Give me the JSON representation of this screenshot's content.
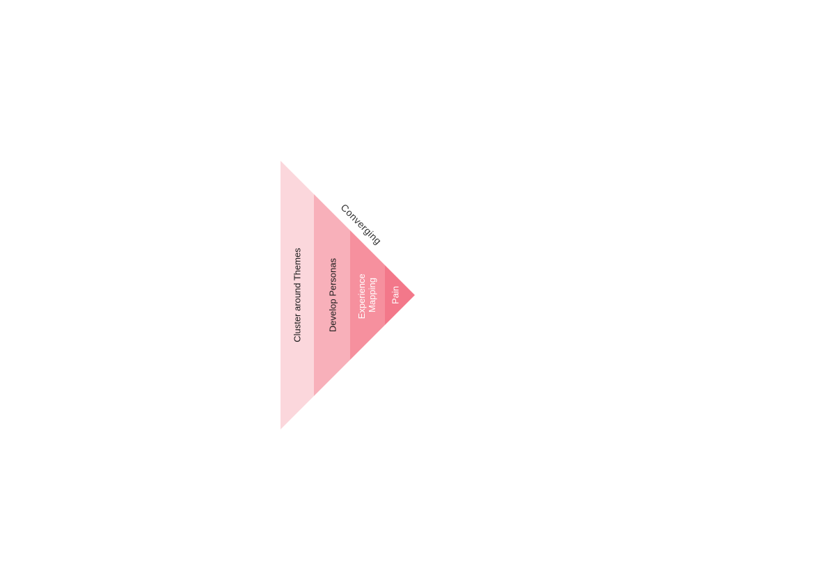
{
  "diagram": {
    "direction_label": "Converging",
    "stages": [
      {
        "label": "Cluster around Themes",
        "color": "#fbd7dc",
        "text_color": "#1a1a1a"
      },
      {
        "label": "Develop Personas",
        "color": "#f8b0ba",
        "text_color": "#1a1a1a"
      },
      {
        "label_lines": [
          "Experience",
          "Mapping"
        ],
        "color": "#f6909e",
        "text_color": "#ffffff"
      },
      {
        "label": "Pain",
        "color": "#f3788a",
        "text_color": "#ffffff"
      }
    ],
    "direction_label_color": "#333333"
  }
}
